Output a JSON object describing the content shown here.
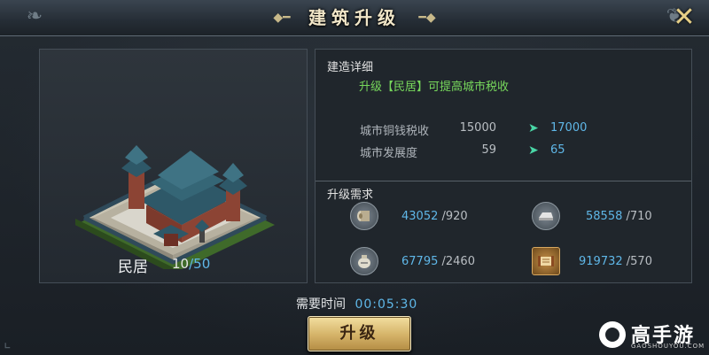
{
  "header": {
    "title": "建筑升级"
  },
  "building": {
    "name": "民居",
    "level_current": "10",
    "level_sep": "/",
    "level_max": "50"
  },
  "details": {
    "heading": "建造详细",
    "description": "升级【民居】可提高城市税收",
    "stats": [
      {
        "label": "城市铜钱税收",
        "old": "15000",
        "new": "17000"
      },
      {
        "label": "城市发展度",
        "old": "59",
        "new": "65"
      }
    ]
  },
  "requirements": {
    "heading": "升级需求",
    "items": [
      {
        "icon": "wood-log-icon",
        "have": "43052",
        "need": "/920"
      },
      {
        "icon": "iron-ingot-icon",
        "have": "58558",
        "need": "/710"
      },
      {
        "icon": "grain-sack-icon",
        "have": "67795",
        "need": "/2460"
      },
      {
        "icon": "scroll-icon",
        "have": "919732",
        "need": "/570"
      }
    ]
  },
  "time": {
    "label": "需要时间",
    "value": "00:05:30"
  },
  "actions": {
    "upgrade_label": "升级"
  },
  "watermark": {
    "brand": "高手游",
    "sub": "GAOSHOUYOU.COM"
  },
  "colors": {
    "accent_blue": "#5fb7e8",
    "green_text": "#77d85c",
    "arrow_green": "#49d6a6",
    "button_gold": "#d4b267"
  }
}
